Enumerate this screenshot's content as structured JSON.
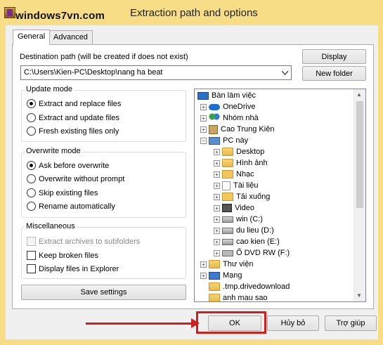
{
  "window": {
    "title": "Extraction path and options",
    "watermark": "windows7vn.com"
  },
  "tabs": [
    {
      "label": "General",
      "active": true
    },
    {
      "label": "Advanced",
      "active": false
    }
  ],
  "destination": {
    "label": "Destination path (will be created if does not exist)",
    "value": "C:\\Users\\Kien-PC\\Desktop\\nang ha beat"
  },
  "side_buttons": {
    "display": "Display",
    "new_folder": "New folder"
  },
  "update_mode": {
    "title": "Update mode",
    "options": [
      {
        "label": "Extract and replace files",
        "selected": true
      },
      {
        "label": "Extract and update files",
        "selected": false
      },
      {
        "label": "Fresh existing files only",
        "selected": false
      }
    ]
  },
  "overwrite_mode": {
    "title": "Overwrite mode",
    "options": [
      {
        "label": "Ask before overwrite",
        "selected": true
      },
      {
        "label": "Overwrite without prompt",
        "selected": false
      },
      {
        "label": "Skip existing files",
        "selected": false
      },
      {
        "label": "Rename automatically",
        "selected": false
      }
    ]
  },
  "misc": {
    "title": "Miscellaneous",
    "options": [
      {
        "label": "Extract archives to subfolders",
        "checked": false,
        "disabled": true
      },
      {
        "label": "Keep broken files",
        "checked": false,
        "disabled": false
      },
      {
        "label": "Display files in Explorer",
        "checked": false,
        "disabled": false
      }
    ]
  },
  "save_settings": "Save settings",
  "tree": [
    {
      "label": "Bàn làm việc",
      "icon": "monitor-icon"
    },
    {
      "label": "OneDrive",
      "icon": "cloud-icon"
    },
    {
      "label": "Nhóm nhà",
      "icon": "homegroup-icon"
    },
    {
      "label": "Cao Trung Kiên",
      "icon": "user-folder-icon"
    },
    {
      "label": "PC này",
      "icon": "computer-icon"
    },
    {
      "label": "Desktop",
      "icon": "folder-icon"
    },
    {
      "label": "Hình ảnh",
      "icon": "pictures-icon"
    },
    {
      "label": "Nhạc",
      "icon": "music-icon"
    },
    {
      "label": "Tài liệu",
      "icon": "documents-icon"
    },
    {
      "label": "Tải xuống",
      "icon": "downloads-icon"
    },
    {
      "label": "Video",
      "icon": "video-icon"
    },
    {
      "label": "win (C:)",
      "icon": "drive-icon"
    },
    {
      "label": "du lieu (D:)",
      "icon": "drive-icon"
    },
    {
      "label": "cao kien (E:)",
      "icon": "drive-icon"
    },
    {
      "label": "Ổ DVD RW (F:)",
      "icon": "dvd-icon"
    },
    {
      "label": "Thư viện",
      "icon": "library-icon"
    },
    {
      "label": "Mạng",
      "icon": "network-icon"
    },
    {
      "label": ".tmp.drivedownload",
      "icon": "folder-icon"
    },
    {
      "label": "anh mau sao",
      "icon": "folder-icon"
    }
  ],
  "footer": {
    "ok": "OK",
    "cancel": "Hủy bỏ",
    "help": "Trợ giúp"
  },
  "colors": {
    "titlebar": "#f6dd86",
    "annotation": "#cf1f1f"
  }
}
